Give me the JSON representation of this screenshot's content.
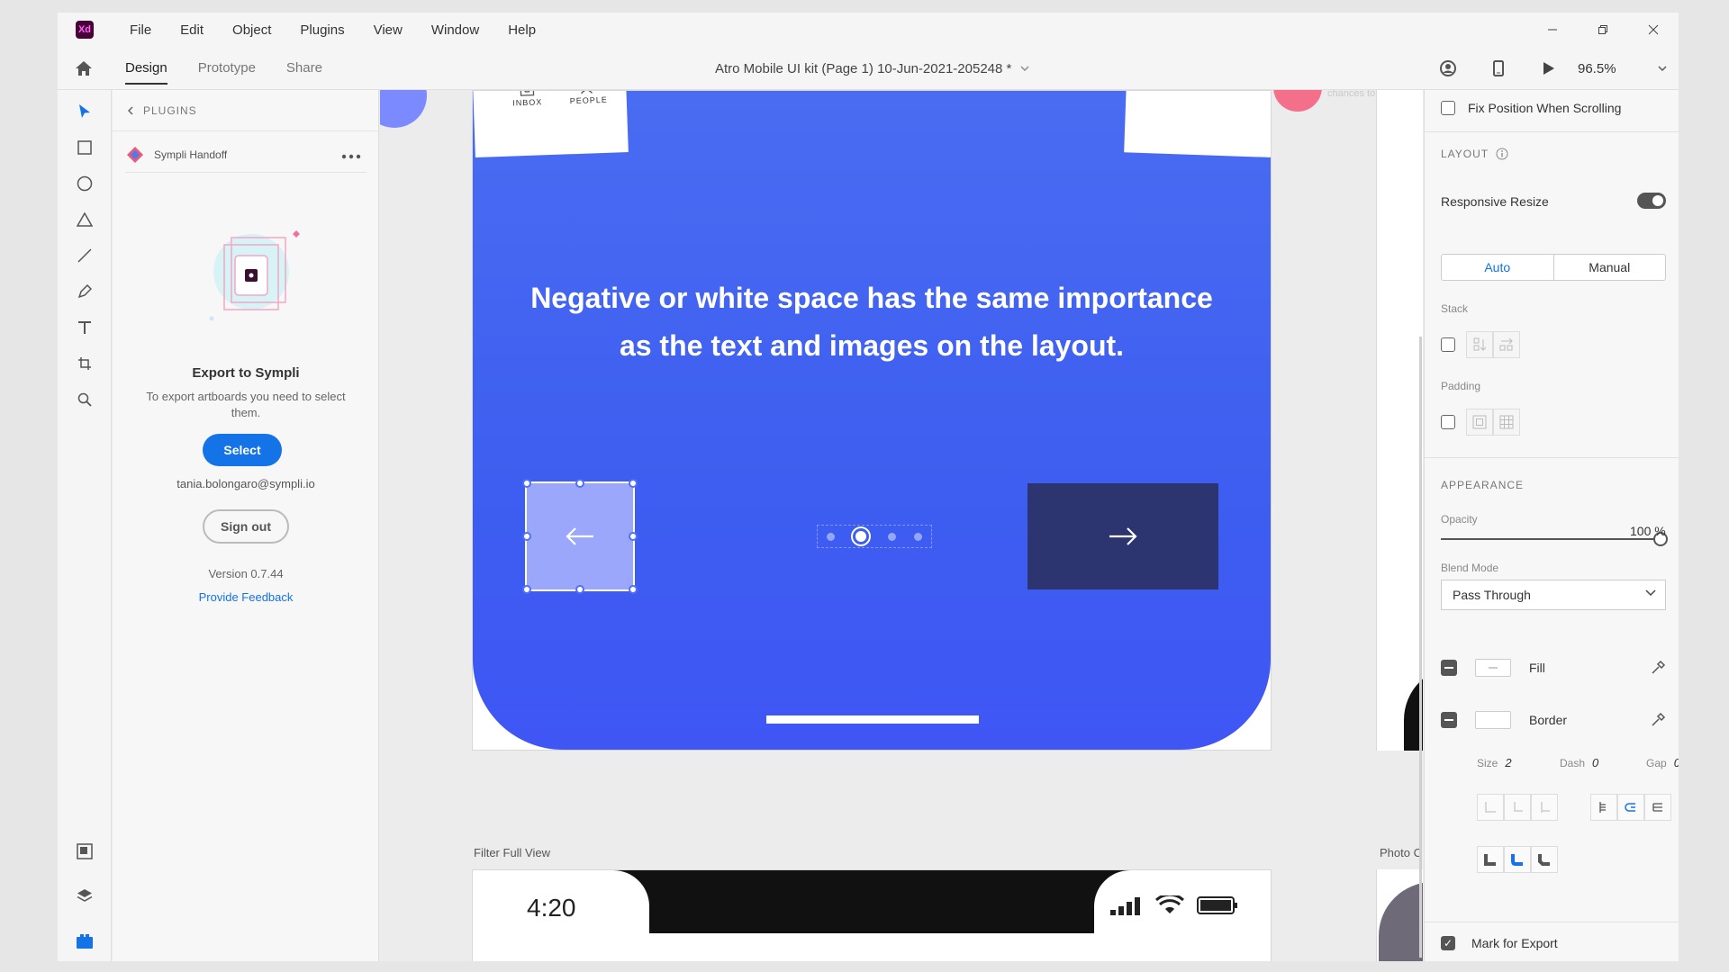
{
  "app": {
    "logo": "Xd",
    "menu": [
      "File",
      "Edit",
      "Object",
      "Plugins",
      "View",
      "Window",
      "Help"
    ]
  },
  "toolbar": {
    "tabs": [
      "Design",
      "Prototype",
      "Share"
    ],
    "document_title": "Atro Mobile UI kit (Page 1) 10-Jun-2021-205248 *",
    "zoom": "96.5%"
  },
  "plugins": {
    "header": "PLUGINS",
    "plugin_name": "Sympli Handoff",
    "export_title": "Export to Sympli",
    "export_desc": "To export artboards you need to select them.",
    "select_label": "Select",
    "email": "tania.bolongaro@sympli.io",
    "signout_label": "Sign out",
    "version": "Version 0.7.44",
    "feedback": "Provide Feedback"
  },
  "canvas": {
    "nav_inbox": "INBOX",
    "nav_people": "PEOPLE",
    "headline": "Negative or white space has the same importance as the text and images on the layout.",
    "faint_text": "chances to succe",
    "filter_label": "Filter Full View",
    "photo_label": "Photo C",
    "time": "4:20"
  },
  "inspector": {
    "fix_position": "Fix Position When Scrolling",
    "layout_title": "LAYOUT",
    "responsive_resize": "Responsive Resize",
    "auto": "Auto",
    "manual": "Manual",
    "stack": "Stack",
    "padding": "Padding",
    "appearance_title": "APPEARANCE",
    "opacity_label": "Opacity",
    "opacity_value": "100 %",
    "blend_label": "Blend Mode",
    "blend_value": "Pass Through",
    "fill": "Fill",
    "border": "Border",
    "size_label": "Size",
    "size_value": "2",
    "dash_label": "Dash",
    "dash_value": "0",
    "gap_label": "Gap",
    "gap_value": "0",
    "mark_export": "Mark for Export"
  },
  "colors": {
    "accent": "#1473e6",
    "artboard_blue": "#3d5ef0",
    "next_button": "#2d3570",
    "prev_button": "#9aa7fb"
  }
}
